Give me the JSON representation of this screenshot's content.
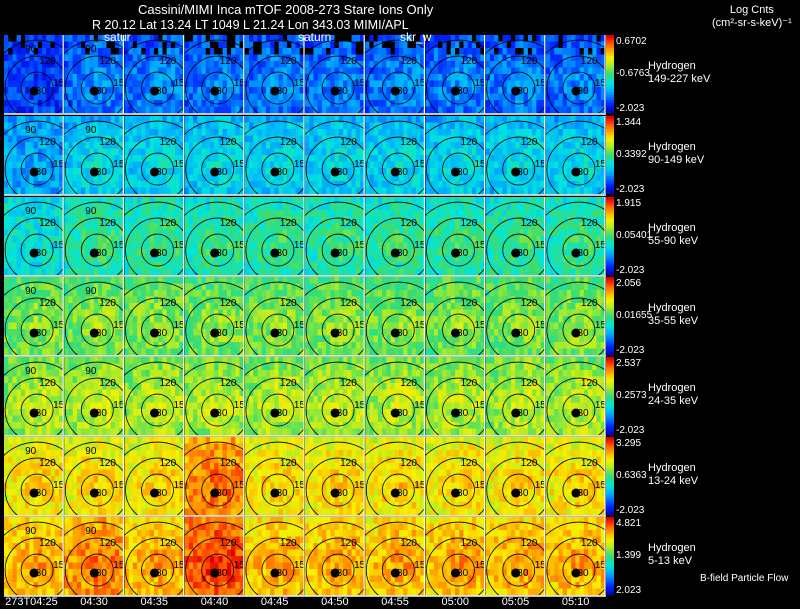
{
  "header": {
    "title_line": "Cassini/MIMI Inca mTOF  2008-273   Stare   Ions Only",
    "ephemeris_line": "R      20.12 Lat 13.24 LT 1049 L       21.24 Lon         343.03  MIMI/APL",
    "location_labels": [
      "satur",
      "saturn",
      "skr_w"
    ]
  },
  "units": {
    "line1": "Log Cnts",
    "line2": "(cm²-sr-s-keV)⁻¹"
  },
  "footer_note": "B-field Particle Flow",
  "chart_data": {
    "type": "heatmap",
    "description_rows_top_to_bottom": "energy channels",
    "time_ticks": [
      "273T04:25",
      "04:30",
      "04:35",
      "04:40",
      "04:45",
      "04:50",
      "04:55",
      "05:00",
      "05:05",
      "05:10"
    ],
    "contour_labels": [
      "90",
      "120",
      "150",
      "180"
    ],
    "rows": [
      {
        "species": "Hydrogen",
        "energy": "149-227 keV",
        "cbar_max": "0.6702",
        "cbar_mid": "-0.6763",
        "cbar_min": "-2.023",
        "level": 0.15
      },
      {
        "species": "Hydrogen",
        "energy": "90-149 keV",
        "cbar_max": "1.344",
        "cbar_mid": "0.3392",
        "cbar_min": "-2.023",
        "level": 0.28
      },
      {
        "species": "Hydrogen",
        "energy": "55-90 keV",
        "cbar_max": "1.915",
        "cbar_mid": "0.05401",
        "cbar_min": "-2.023",
        "level": 0.4
      },
      {
        "species": "Hydrogen",
        "energy": "35-55 keV",
        "cbar_max": "2.056",
        "cbar_mid": "0.01655",
        "cbar_min": "-2.023",
        "level": 0.5
      },
      {
        "species": "Hydrogen",
        "energy": "24-35 keV",
        "cbar_max": "2.537",
        "cbar_mid": "0.2573",
        "cbar_min": "-2.023",
        "level": 0.55
      },
      {
        "species": "Hydrogen",
        "energy": "13-24 keV",
        "cbar_max": "3.295",
        "cbar_mid": "0.6363",
        "cbar_min": "-2.023",
        "level": 0.66
      },
      {
        "species": "Hydrogen",
        "energy": "5-13 keV",
        "cbar_max": "4.821",
        "cbar_mid": "1.399",
        "cbar_min": "2.023",
        "level": 0.72
      }
    ]
  }
}
